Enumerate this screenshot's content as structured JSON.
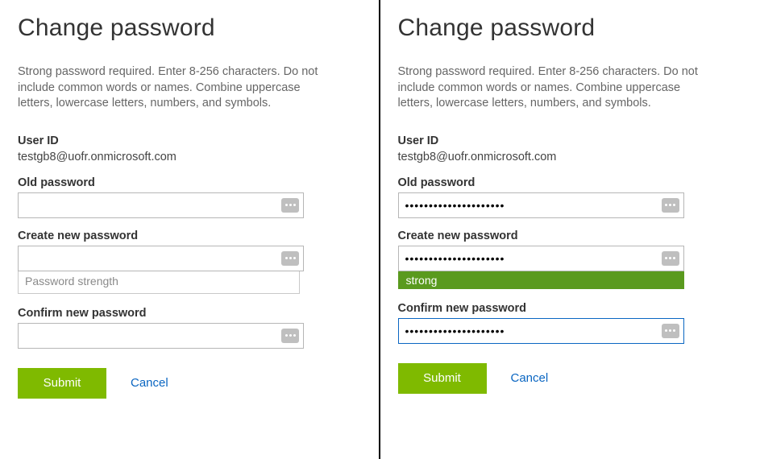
{
  "left": {
    "heading": "Change password",
    "instructions": "Strong password required. Enter 8-256 characters. Do not include common words or names. Combine uppercase letters, lowercase letters, numbers, and symbols.",
    "userIdLabel": "User ID",
    "userIdValue": "testgb8@uofr.onmicrosoft.com",
    "oldPwLabel": "Old password",
    "oldPwValue": "",
    "newPwLabel": "Create new password",
    "newPwValue": "",
    "strengthPlaceholder": "Password strength",
    "confirmPwLabel": "Confirm new password",
    "confirmPwValue": "",
    "submitLabel": "Submit",
    "cancelLabel": "Cancel"
  },
  "right": {
    "heading": "Change password",
    "instructions": "Strong password required. Enter 8-256 characters. Do not include common words or names. Combine uppercase letters, lowercase letters, numbers, and symbols.",
    "userIdLabel": "User ID",
    "userIdValue": "testgb8@uofr.onmicrosoft.com",
    "oldPwLabel": "Old password",
    "oldPwValue": "•••••••••••••••••••••",
    "newPwLabel": "Create new password",
    "newPwValue": "•••••••••••••••••••••",
    "strengthText": "strong",
    "strengthColor": "#5a9a1e",
    "confirmPwLabel": "Confirm new password",
    "confirmPwValue": "•••••••••••••••••••••",
    "submitLabel": "Submit",
    "cancelLabel": "Cancel"
  },
  "colors": {
    "accent": "#7fba00",
    "link": "#0a66c2",
    "focusBorder": "#0a66c2"
  }
}
